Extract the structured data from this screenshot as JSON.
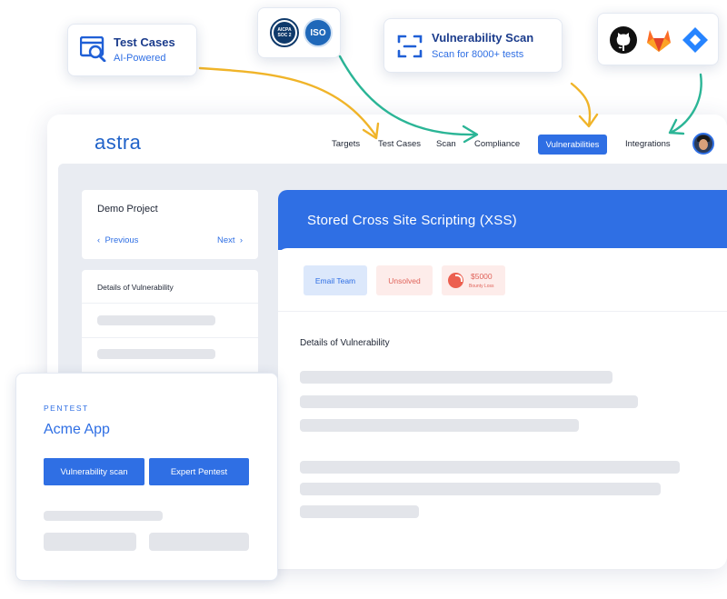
{
  "app": {
    "logo": "astra",
    "nav": {
      "targets": "Targets",
      "test_cases": "Test Cases",
      "scan": "Scan",
      "compliance": "Compliance",
      "vulnerabilities": "Vulnerabilities",
      "integrations": "Integrations"
    }
  },
  "project": {
    "name": "Demo Project",
    "prev": "Previous",
    "next": "Next"
  },
  "vuln_list": {
    "title": "Details of Vulnerability"
  },
  "detail": {
    "title": "Stored Cross Site Scripting (XSS)",
    "tags": {
      "email_team": "Email Team",
      "status": "Unsolved",
      "bounty_amount": "$5000",
      "bounty_label": "Bounty Loss"
    },
    "section_title": "Details of Vulnerability"
  },
  "feature_cards": {
    "test_cases": {
      "title": "Test Cases",
      "subtitle": "AI-Powered"
    },
    "certifications": {
      "soc2": "AICPA SOC 2",
      "iso": "ISO"
    },
    "vuln_scan": {
      "title": "Vulnerability Scan",
      "subtitle": "Scan for 8000+ tests"
    },
    "integrations": [
      "github-icon",
      "gitlab-icon",
      "jira-icon"
    ]
  },
  "pentest_card": {
    "kicker": "PENTEST",
    "app_name": "Acme App",
    "button_vuln_scan": "Vulnerability scan",
    "button_expert": "Expert Pentest"
  },
  "colors": {
    "primary": "#2f6fe4",
    "navy": "#1b3c8c",
    "arrow_yellow": "#f0b429",
    "arrow_green": "#2bb596",
    "danger": "#e0635a"
  }
}
